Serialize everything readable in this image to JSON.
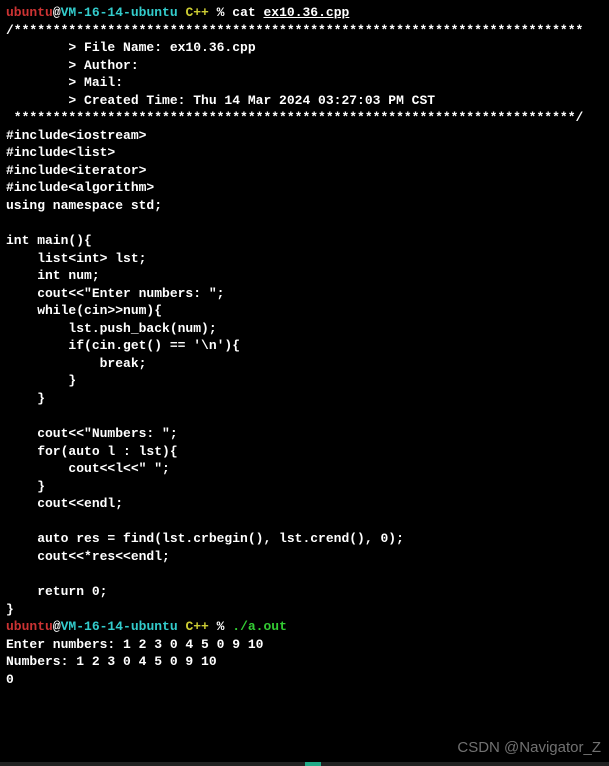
{
  "prompt1": {
    "user": "ubuntu",
    "at": "@",
    "host": "VM-16-14-ubuntu",
    "dir": " C++",
    "pct": " % ",
    "cmd": "cat ",
    "arg": "ex10.36.cpp"
  },
  "source": {
    "border_top": "/*************************************************************************",
    "meta1": "        > File Name: ex10.36.cpp",
    "meta2": "        > Author:",
    "meta3": "        > Mail:",
    "meta4": "        > Created Time: Thu 14 Mar 2024 03:27:03 PM CST",
    "border_bot": " ************************************************************************/",
    "blank": "",
    "inc1": "#include<iostream>",
    "inc2": "#include<list>",
    "inc3": "#include<iterator>",
    "inc4": "#include<algorithm>",
    "usng": "using namespace std;",
    "main0": "int main(){",
    "main1": "    list<int> lst;",
    "main2": "    int num;",
    "main3": "    cout<<\"Enter numbers: \";",
    "main4": "    while(cin>>num){",
    "main5": "        lst.push_back(num);",
    "main6": "        if(cin.get() == '\\n'){",
    "main7": "            break;",
    "main8": "        }",
    "main9": "    }",
    "main10": "    cout<<\"Numbers: \";",
    "main11": "    for(auto l : lst){",
    "main12": "        cout<<l<<\" \";",
    "main13": "    }",
    "main14": "    cout<<endl;",
    "main15": "    auto res = find(lst.crbegin(), lst.crend(), 0);",
    "main16": "    cout<<*res<<endl;",
    "main17": "    return 0;",
    "main18": "}"
  },
  "prompt2": {
    "user": "ubuntu",
    "at": "@",
    "host": "VM-16-14-ubuntu",
    "dir": " C++",
    "pct": " % ",
    "cmd": "./a.out"
  },
  "output": {
    "l1": "Enter numbers: 1 2 3 0 4 5 0 9 10",
    "l2": "Numbers: 1 2 3 0 4 5 0 9 10",
    "l3": "0"
  },
  "watermark": "CSDN @Navigator_Z"
}
